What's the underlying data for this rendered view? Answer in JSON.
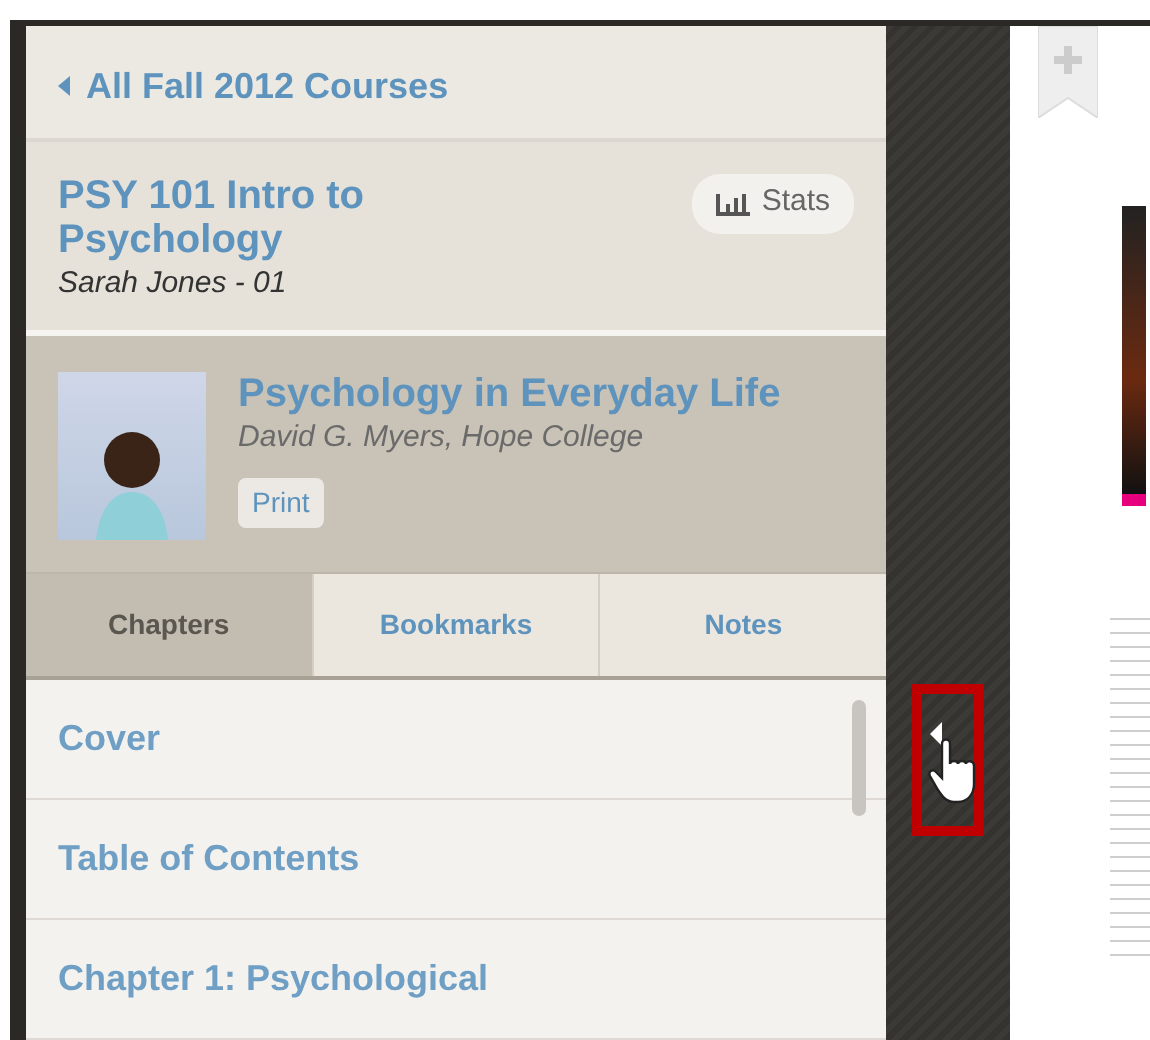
{
  "back_link": {
    "label": "All Fall 2012 Courses"
  },
  "course": {
    "title": "PSY 101 Intro to Psychology",
    "instructor": "Sarah Jones - 01",
    "stats_button": "Stats"
  },
  "book": {
    "title": "Psychology in Everyday Life",
    "author": "David G. Myers, Hope College",
    "print_button": "Print"
  },
  "tabs": [
    {
      "label": "Chapters",
      "selected": true
    },
    {
      "label": "Bookmarks",
      "selected": false
    },
    {
      "label": "Notes",
      "selected": false
    }
  ],
  "chapters": [
    {
      "label": "Cover"
    },
    {
      "label": "Table of Contents"
    },
    {
      "label": "Chapter 1: Psychological"
    }
  ]
}
